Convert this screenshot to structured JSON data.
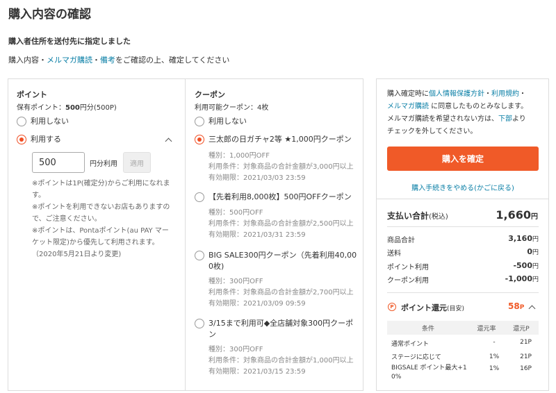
{
  "page": {
    "title": "購入内容の確認",
    "subtitle": "購入者住所を送付先に指定しました",
    "confirm_line": {
      "prefix": "購入内容・",
      "link1": "メルマガ購読",
      "sep": "・",
      "link2": "備考",
      "suffix": "をご確認の上、確定してください"
    }
  },
  "points": {
    "heading": "ポイント",
    "owned_label": "保有ポイント：",
    "owned_value": "500",
    "owned_unit": "円分(500P)",
    "options": [
      {
        "label": "利用しない",
        "selected": false
      },
      {
        "label": "利用する",
        "selected": true
      }
    ],
    "input_value": "500",
    "input_unit": "円分利用",
    "apply_label": "適用",
    "notes": [
      "※ポイントは1P(確定分)からご利用になれま",
      "す。",
      "※ポイントを利用できないお店もありますの",
      "で、ご注意ください。",
      "※ポイントは、Pontaポイント(au PAY マー",
      "ケット限定)から優先して利用されます。",
      "（2020年5月21日より変更)"
    ]
  },
  "coupons": {
    "heading": "クーポン",
    "available": "利用可能クーポン：4枚",
    "none_label": "利用しない",
    "items": [
      {
        "name_lines": [
          "三太郎の日ガチャ2等 ★1,000円クーポン"
        ],
        "selected": true,
        "type": "種別：1,000円OFF",
        "condition": "利用条件：対象商品の合計金額が3,000円以上",
        "expiry": "有効期限：2021/03/03 23:59"
      },
      {
        "name_lines": [
          "【先着利用8,000枚】500円OFFクーポン"
        ],
        "selected": false,
        "type": "種別：500円OFF",
        "condition": "利用条件：対象商品の合計金額が2,500円以上",
        "expiry": "有効期限：2021/03/31 23:59"
      },
      {
        "name_lines": [
          "BIG SALE300円クーポン（先着利用40,00",
          "0枚)"
        ],
        "selected": false,
        "type": "種別：300円OFF",
        "condition": "利用条件：対象商品の合計金額が2,700円以上",
        "expiry": "有効期限：2021/03/09 09:59"
      },
      {
        "name_lines": [
          "3/15まで利用可◆全店舗対象300円クーポ",
          "ン"
        ],
        "selected": false,
        "type": "種別：300円OFF",
        "condition": "利用条件：対象商品の合計金額が1,000円以上",
        "expiry": "有効期限：2021/03/15 23:59"
      }
    ]
  },
  "agreement": {
    "t1": "購入確定時に",
    "l1": "個人情報保護方針",
    "t2": "・",
    "l2": "利用規約",
    "t3": "・",
    "l3": "メルマガ購読",
    "t4": " に同意したものとみなします。",
    "t5": "メルマガ購読を希望されない方は、",
    "l4": "下部",
    "t6": "より",
    "t7": "チェックを外してください。"
  },
  "actions": {
    "confirm": "購入を確定",
    "cancel": "購入手続きをやめる(かごに戻る)"
  },
  "summary": {
    "total_label": "支払い合計",
    "total_tax": "(税込)",
    "total_value": "1,660",
    "yen": "円",
    "rows": [
      {
        "label": "商品合計",
        "value": "3,160"
      },
      {
        "label": "送料",
        "value": "0"
      },
      {
        "label": "ポイント利用",
        "value": "-500"
      },
      {
        "label": "クーポン利用",
        "value": "-1,000"
      }
    ]
  },
  "point_back": {
    "icon": "P",
    "label": "ポイント還元",
    "note": "(目安)",
    "value": "58",
    "unit": "P",
    "headers": [
      "条件",
      "還元率",
      "還元P"
    ],
    "rows": [
      {
        "cond": "通常ポイント",
        "rate": "-",
        "pts": "21P"
      },
      {
        "cond": "ステージに応じて",
        "rate": "1%",
        "pts": "21P"
      },
      {
        "cond": "BIGSALE ポイント最大+1",
        "cond2": "0%",
        "rate": "1%",
        "pts": "16P"
      }
    ]
  },
  "colors": {
    "accent": "#f05a28",
    "link": "#0a7fa6",
    "border": "#dcdcdc"
  }
}
